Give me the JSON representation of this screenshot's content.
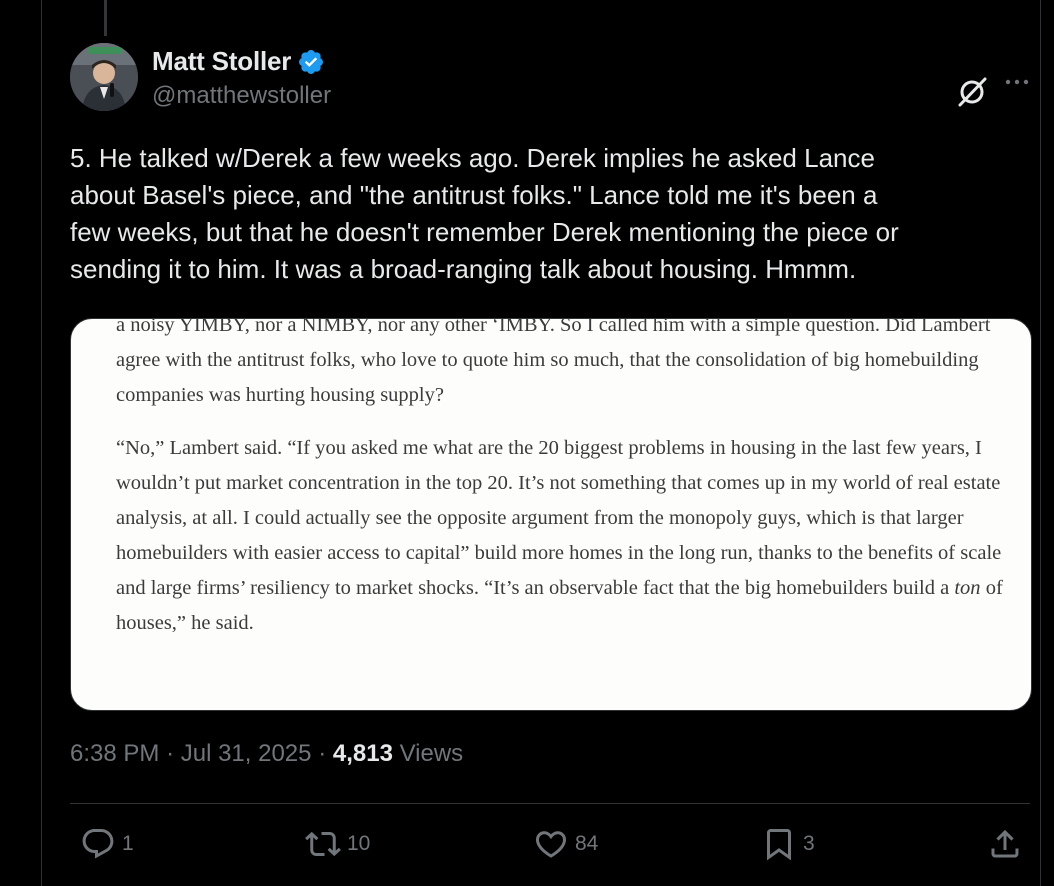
{
  "author": {
    "display_name": "Matt Stoller",
    "handle": "@matthewstoller",
    "verified": true
  },
  "tweet": {
    "text": "5. He talked w/Derek a few weeks ago. Derek implies he asked Lance\nabout Basel's piece, and \"the antitrust folks.\" Lance told me it's been a\nfew weeks, but that he doesn't remember Derek mentioning the piece or\nsending it to him. It was a broad-ranging talk about housing. Hmmm."
  },
  "media": {
    "para1": "a noisy YIMBY, nor a NIMBY, nor any other ‘IMBY. So I called him with a simple question. Did Lambert agree with the antitrust folks, who love to quote him so much, that the consolidation of big homebuilding companies was hurting housing supply?",
    "para2_before_italic": "“No,” Lambert said. “If you asked me what are the 20 biggest problems in housing in the last few years, I wouldn’t put market concentration in the top 20. It’s not something that comes up in my world of real estate analysis, at all. I could actually see the opposite argument from the monopoly guys, which is that larger homebuilders with easier access to capital” build more homes in the long run, thanks to the benefits of scale and large firms’ resiliency to market shocks. “It’s an observable fact that the big homebuilders build a ",
    "para2_italic": "ton",
    "para2_after_italic": " of houses,” he said."
  },
  "meta": {
    "time": "6:38 PM",
    "separator": "·",
    "date": "Jul 31, 2025",
    "views_count": "4,813",
    "views_label": "Views"
  },
  "actions": {
    "replies": "1",
    "reposts": "10",
    "likes": "84",
    "bookmarks": "3"
  },
  "colors": {
    "background": "#000000",
    "text_primary": "#e7e9ea",
    "text_secondary": "#71767b",
    "verified_blue": "#1d9bf0",
    "border": "#2f3336"
  }
}
